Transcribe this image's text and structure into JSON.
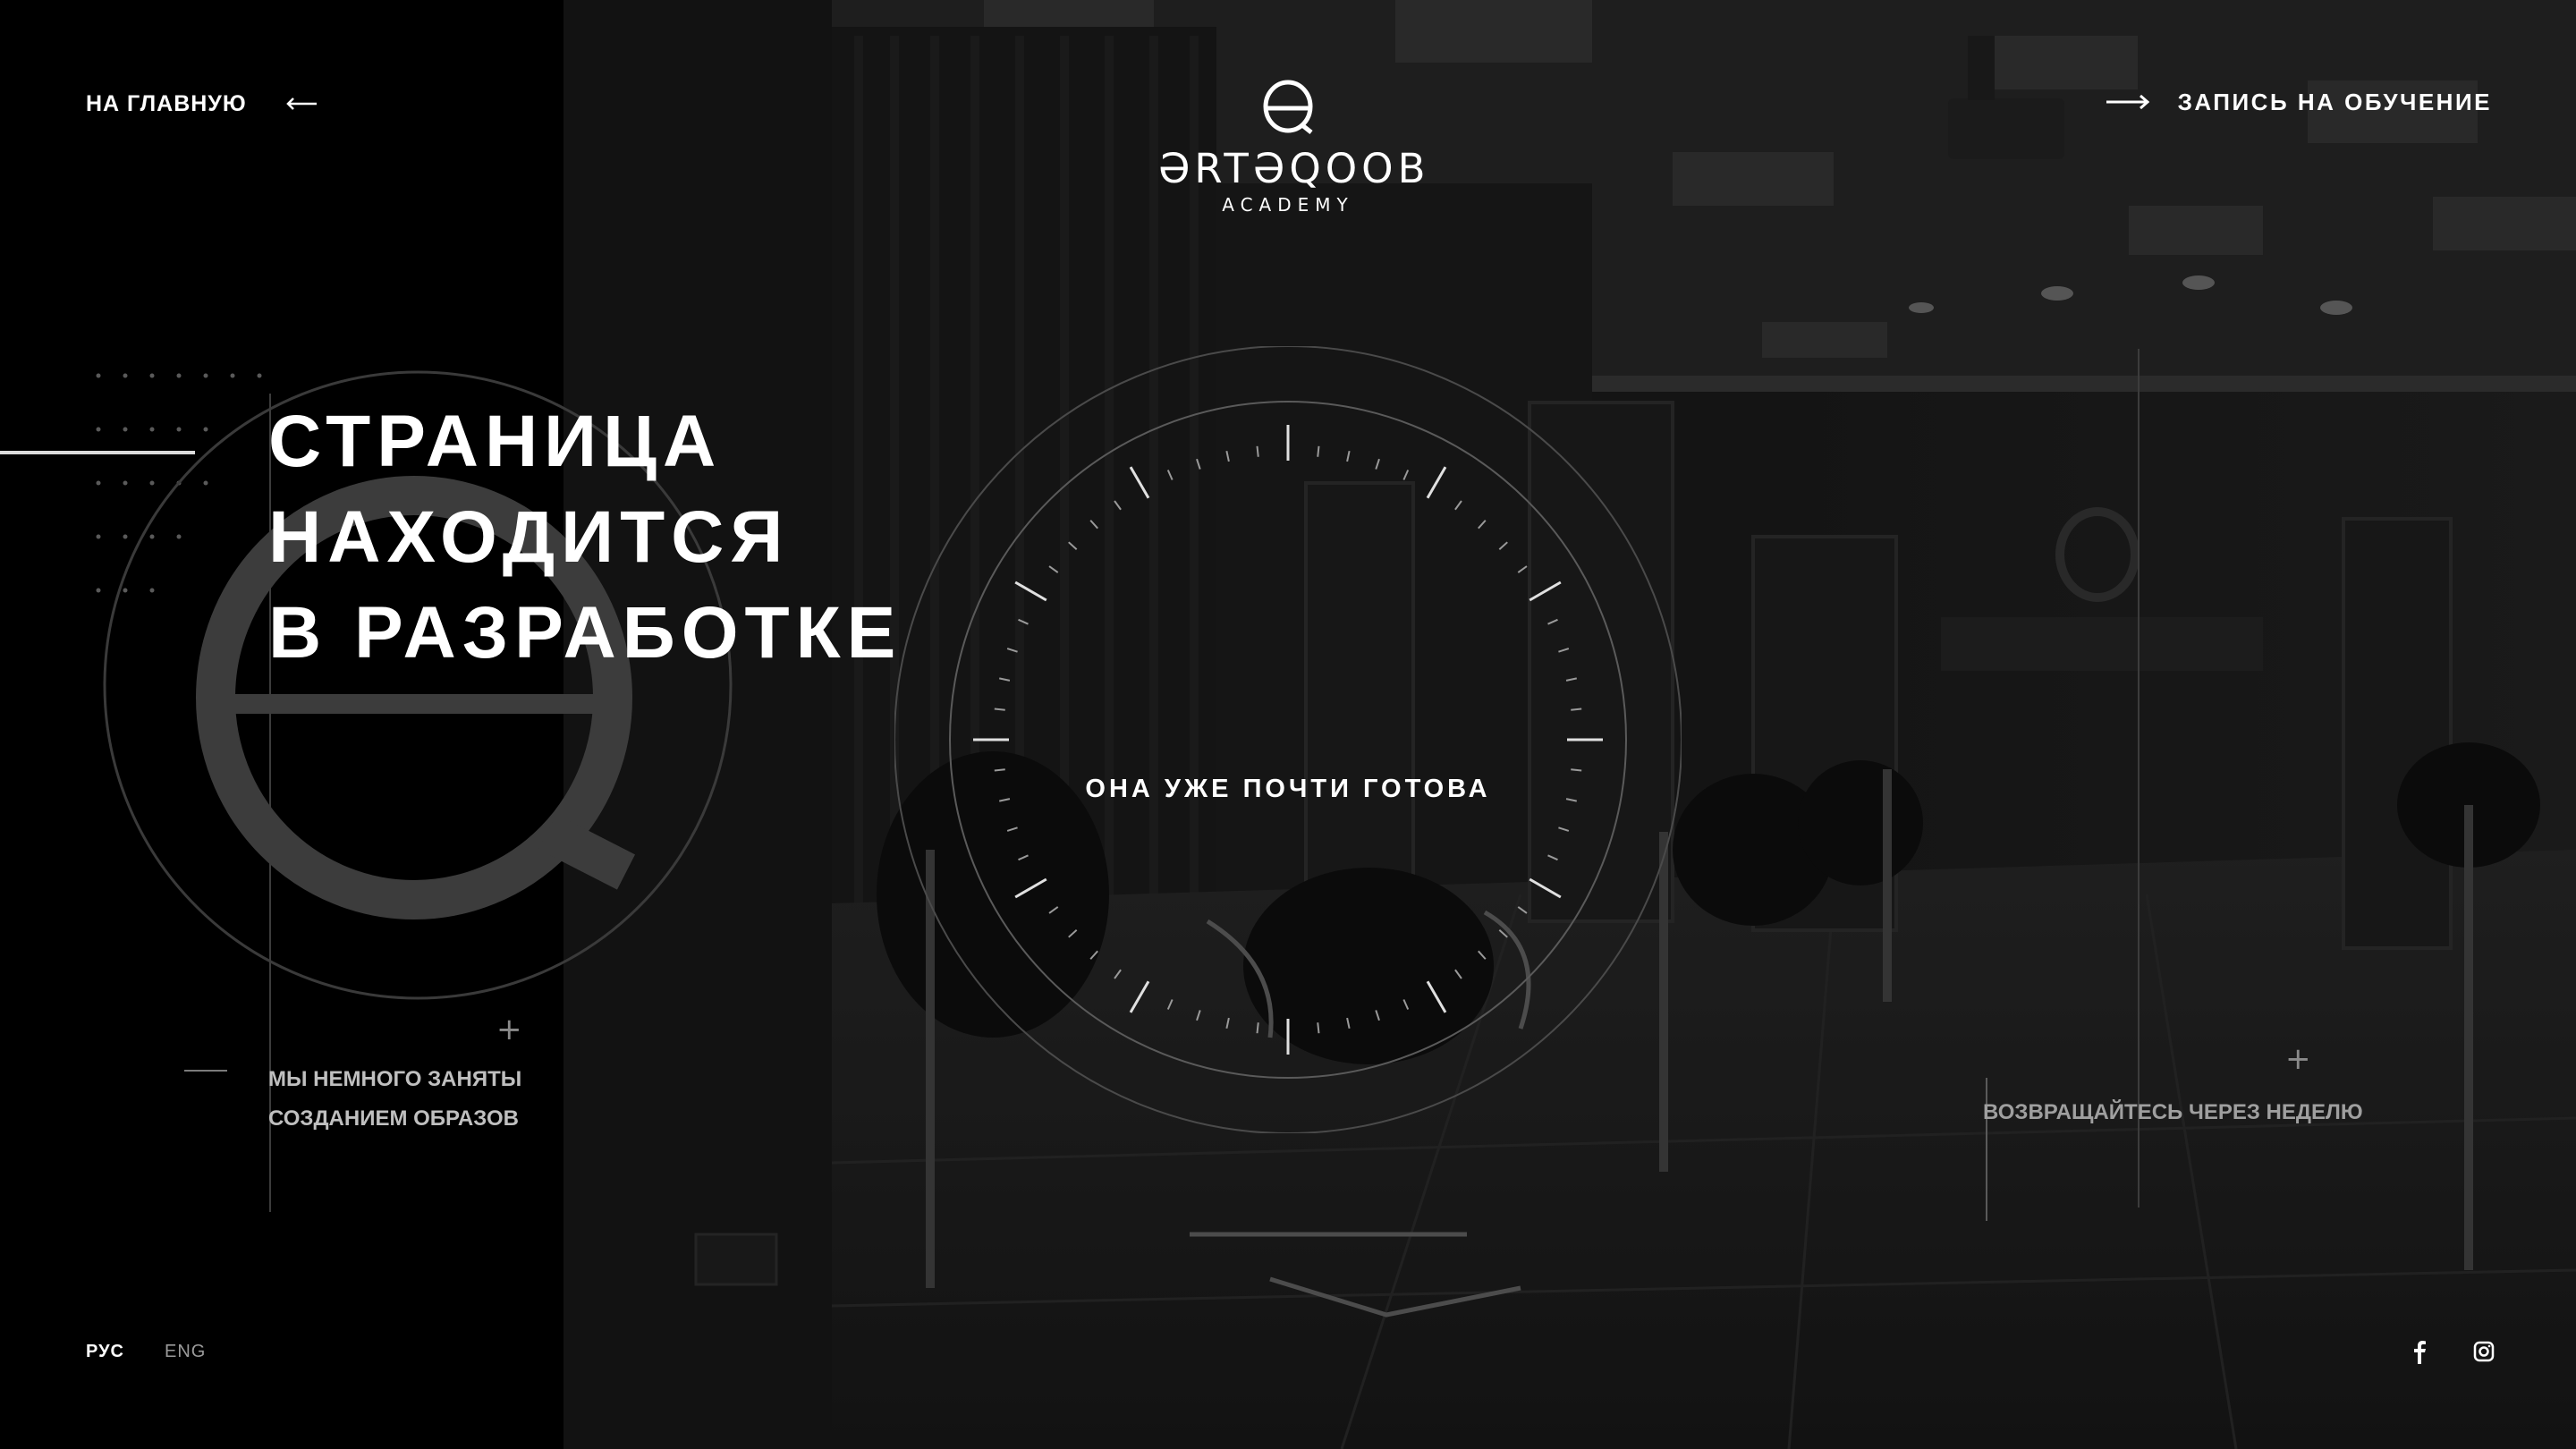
{
  "header": {
    "home_label": "НА ГЛАВНУЮ",
    "enroll_label": "ЗАПИСЬ НА ОБУЧЕНИЕ",
    "logo": {
      "wordmark": "ƏRTƏQOOB",
      "subtitle": "ACADEMY"
    }
  },
  "hero": {
    "headline": [
      "СТРАНИЦА",
      "НАХОДИТСЯ",
      "В РАЗРАБОТКЕ"
    ],
    "center_text": "ОНА УЖЕ ПОЧТИ ГОТОВА"
  },
  "captions": {
    "left": [
      "МЫ НЕМНОГО ЗАНЯТЫ",
      "СОЗДАНИЕМ ОБРАЗОВ"
    ],
    "right": "ВОЗВРАЩАЙТЕСЬ ЧЕРЕЗ НЕДЕЛЮ"
  },
  "footer": {
    "languages": [
      "РУС",
      "ENG"
    ],
    "active_language": "РУС"
  },
  "icons": {
    "home_arrow": "arrow-left-icon",
    "enroll_arrow": "arrow-right-icon",
    "social": [
      "facebook-icon",
      "instagram-icon"
    ]
  },
  "colors": {
    "background": "#161616",
    "left_panel": "#000000",
    "text": "#ffffff",
    "muted": "#9a9a9a"
  }
}
